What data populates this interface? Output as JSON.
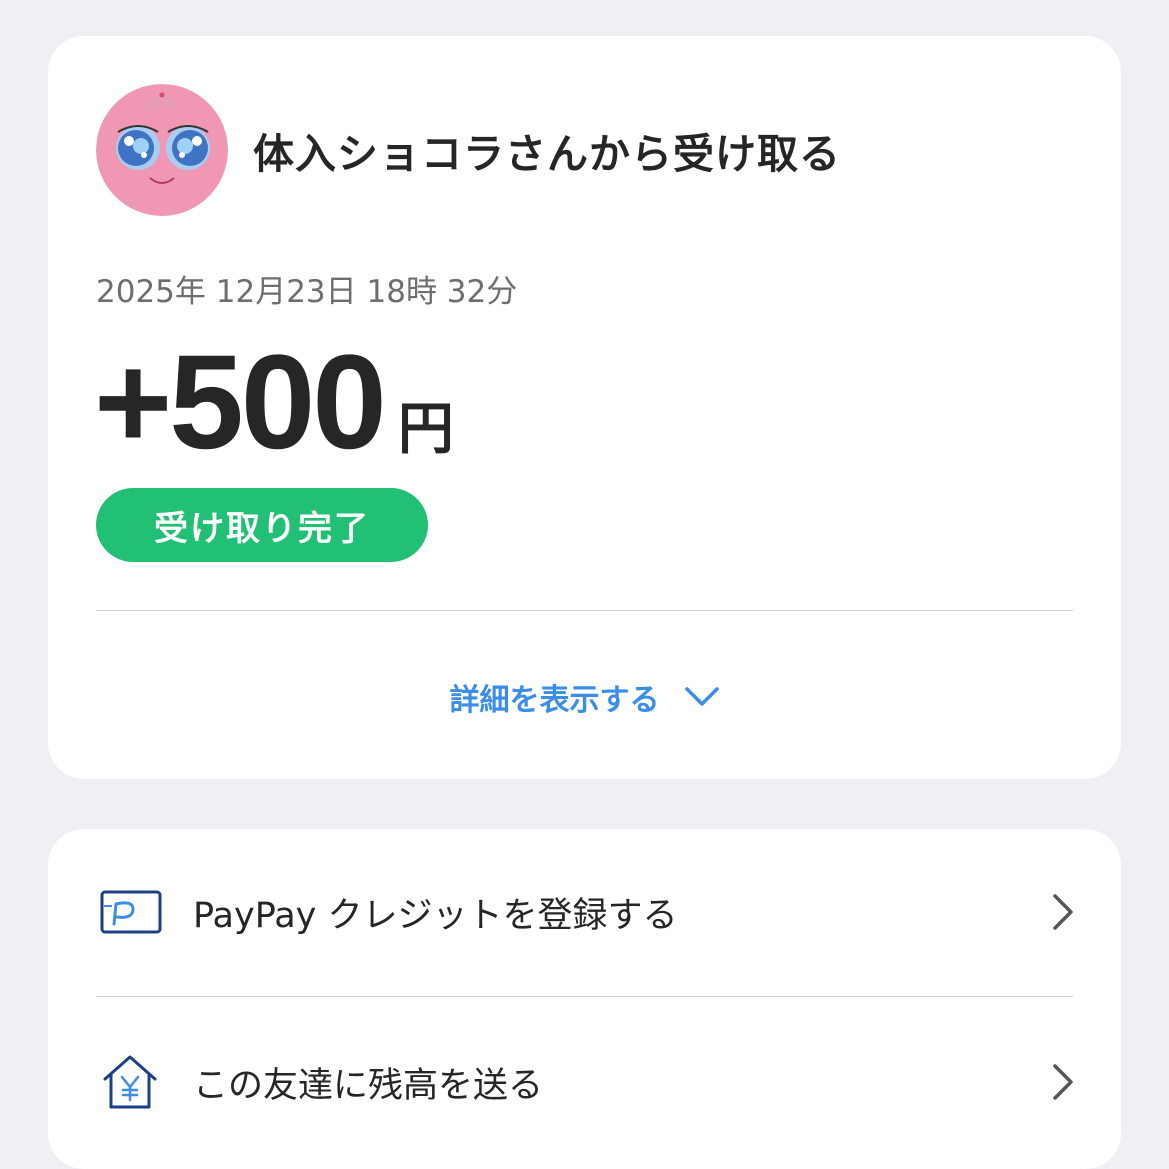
{
  "transaction": {
    "title": "体入ショコラさんから受け取る",
    "datetime": "2025年 12月23日 18時 32分",
    "amount": "+500",
    "currency": "円",
    "status": "受け取り完了",
    "details_label": "詳細を表示する"
  },
  "menu": {
    "items": [
      {
        "label": "PayPay クレジットを登録する",
        "icon": "paypay-card-icon"
      },
      {
        "label": "この友達に残高を送る",
        "icon": "yen-house-icon"
      }
    ]
  },
  "colors": {
    "background": "#eff0f4",
    "card": "#ffffff",
    "status_green": "#22c074",
    "link_blue": "#3a8ee8",
    "icon_navy": "#1e3f87",
    "avatar_pink": "#f097b3"
  }
}
